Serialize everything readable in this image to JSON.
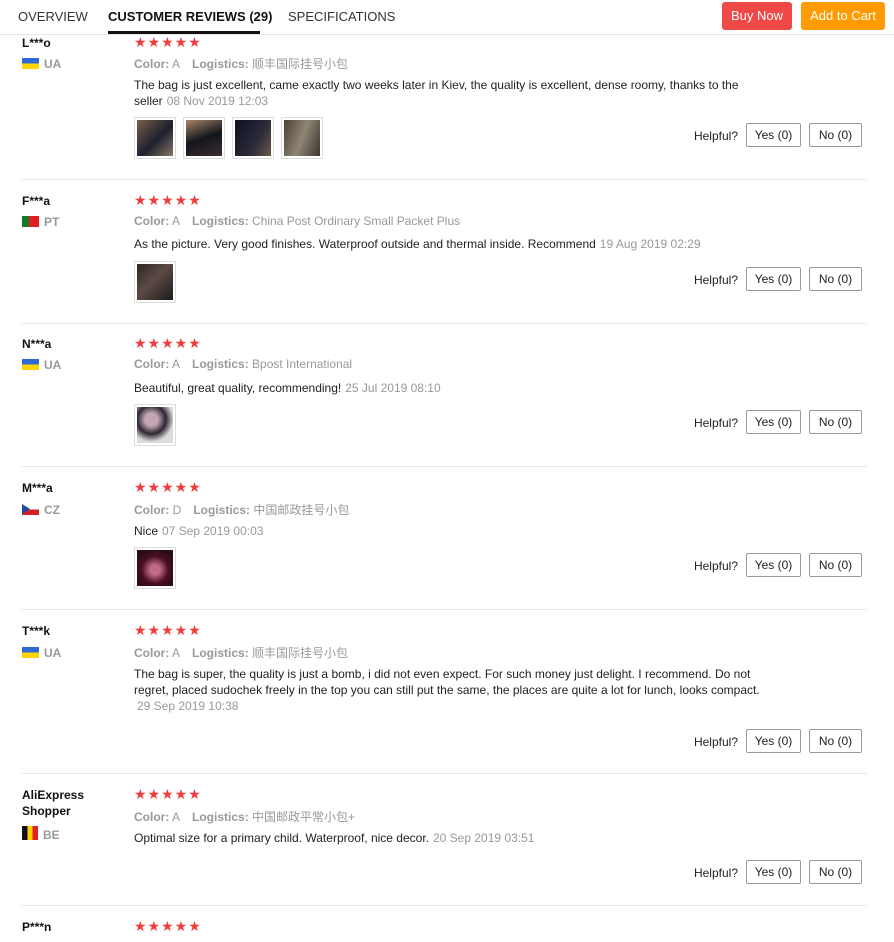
{
  "tabs": {
    "overview": "OVERVIEW",
    "reviews": "CUSTOMER REVIEWS (29)",
    "specs": "SPECIFICATIONS"
  },
  "actions": {
    "buy_now": "Buy Now",
    "add_to_cart": "Add to Cart"
  },
  "labels": {
    "color": "Color:",
    "logistics": "Logistics:",
    "helpful": "Helpful?",
    "stars": "★★★★★"
  },
  "reviews": [
    {
      "name": "L***o",
      "country": "UA",
      "color": "A",
      "logistics": "顺丰国际挂号小包",
      "text": "The bag is just excellent, came exactly two weeks later in Kiev, the quality is excellent, dense roomy, thanks to the seller",
      "date": "08 Nov 2019 12:03",
      "yes": "Yes (0)",
      "no": "No (0)"
    },
    {
      "name": "F***a",
      "country": "PT",
      "color": "A",
      "logistics": "China Post Ordinary Small Packet Plus",
      "text": "As the picture. Very good finishes. Waterproof outside and thermal inside. Recommend",
      "date": "19 Aug 2019 02:29",
      "yes": "Yes (0)",
      "no": "No (0)"
    },
    {
      "name": "N***a",
      "country": "UA",
      "color": "A",
      "logistics": "Bpost International",
      "text": "Beautiful, great quality, recommending!",
      "date": "25 Jul 2019 08:10",
      "yes": "Yes (0)",
      "no": "No (0)"
    },
    {
      "name": "M***a",
      "country": "CZ",
      "color": "D",
      "logistics": "中国邮政挂号小包",
      "text": "Nice",
      "date": "07 Sep 2019 00:03",
      "yes": "Yes (0)",
      "no": "No (0)"
    },
    {
      "name": "T***k",
      "country": "UA",
      "color": "A",
      "logistics": "顺丰国际挂号小包",
      "text": "The bag is super, the quality is just a bomb, i did not even expect. For such money just delight. I recommend. Do not regret, placed sudochek freely in the top you can still put the same, the places are quite a lot for lunch, looks compact.",
      "date": "29 Sep 2019 10:38",
      "yes": "Yes (0)",
      "no": "No (0)"
    },
    {
      "name": "AliExpress Shopper",
      "country": "BE",
      "color": "A",
      "logistics": "中国邮政平常小包+",
      "text": "Optimal size for a primary child. Waterproof, nice decor.",
      "date": "20 Sep 2019 03:51",
      "yes": "Yes (0)",
      "no": "No (0)"
    },
    {
      "name": "P***n"
    }
  ]
}
